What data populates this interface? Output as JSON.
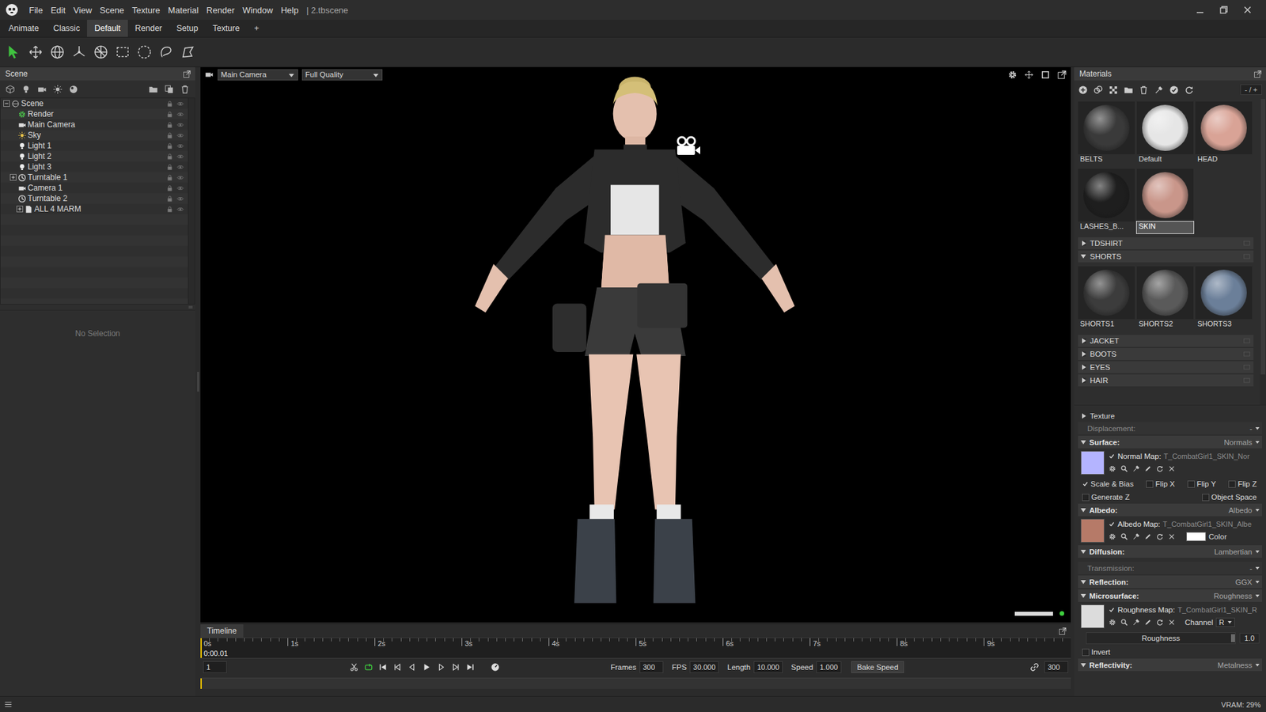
{
  "app": {
    "menu": [
      "File",
      "Edit",
      "View",
      "Scene",
      "Texture",
      "Material",
      "Render",
      "Window",
      "Help"
    ],
    "document": "| 2.tbscene"
  },
  "workspace_tabs": [
    {
      "label": "Animate",
      "selected": false
    },
    {
      "label": "Classic",
      "selected": false
    },
    {
      "label": "Default",
      "selected": true
    },
    {
      "label": "Render",
      "selected": false
    },
    {
      "label": "Setup",
      "selected": false
    },
    {
      "label": "Texture",
      "selected": false
    },
    {
      "label": "+",
      "selected": false
    }
  ],
  "scene": {
    "title": "Scene",
    "tree": [
      {
        "label": "Scene",
        "kind": "scene",
        "depth": 0,
        "expandable": true,
        "expanded": true
      },
      {
        "label": "Render",
        "kind": "render",
        "depth": 1,
        "expandable": false,
        "expanded": false
      },
      {
        "label": "Main Camera",
        "kind": "camera",
        "depth": 1,
        "expandable": false,
        "expanded": false
      },
      {
        "label": "Sky",
        "kind": "sky",
        "depth": 1,
        "expandable": false,
        "expanded": false
      },
      {
        "label": "Light 1",
        "kind": "light",
        "depth": 1,
        "expandable": false,
        "expanded": false
      },
      {
        "label": "Light 2",
        "kind": "light",
        "depth": 1,
        "expandable": false,
        "expanded": false
      },
      {
        "label": "Light 3",
        "kind": "light",
        "depth": 1,
        "expandable": false,
        "expanded": false
      },
      {
        "label": "Turntable 1",
        "kind": "turntable",
        "depth": 1,
        "expandable": true,
        "expanded": false
      },
      {
        "label": "Camera 1",
        "kind": "camera",
        "depth": 1,
        "expandable": false,
        "expanded": false
      },
      {
        "label": "Turntable 2",
        "kind": "turntable",
        "depth": 1,
        "expandable": false,
        "expanded": false
      },
      {
        "label": "ALL 4 MARM",
        "kind": "mesh",
        "depth": 2,
        "expandable": true,
        "expanded": false
      }
    ],
    "selection": "No Selection"
  },
  "viewport": {
    "camera": "Main Camera",
    "quality": "Full Quality"
  },
  "timeline": {
    "title": "Timeline",
    "ticks": [
      "0s",
      "1s",
      "2s",
      "3s",
      "4s",
      "5s",
      "6s",
      "7s",
      "8s",
      "9s"
    ],
    "time": "0:00.01",
    "playhead": 0.0,
    "frame": "1",
    "loop_on": true,
    "fields": [
      {
        "label": "Frames",
        "value": "300"
      },
      {
        "label": "FPS",
        "value": "30.000"
      },
      {
        "label": "Length",
        "value": "10.000"
      },
      {
        "label": "Speed",
        "value": "1.000"
      }
    ],
    "bake": "Bake Speed",
    "end_frame": "300"
  },
  "materials": {
    "title": "Materials",
    "zoom": "- / +",
    "loose": [
      {
        "label": "BELTS",
        "color": "#3a3a3a",
        "selected": false
      },
      {
        "label": "Default",
        "color": "#e6e6e6",
        "selected": false
      },
      {
        "label": "HEAD",
        "color": "#d9a396",
        "selected": false
      },
      {
        "label": "LASHES_B...",
        "color": "#1e1e1e",
        "selected": false
      },
      {
        "label": "SKIN",
        "color": "#c9968a",
        "selected": true
      }
    ],
    "groups": [
      {
        "label": "TDSHIRT",
        "expanded": false,
        "items": []
      },
      {
        "label": "SHORTS",
        "expanded": true,
        "items": [
          {
            "label": "SHORTS1",
            "color": "#3c3c3c",
            "selected": false
          },
          {
            "label": "SHORTS2",
            "color": "#5a5a5a",
            "selected": false
          },
          {
            "label": "SHORTS3",
            "color": "#6b7f99",
            "selected": false
          }
        ]
      },
      {
        "label": "JACKET",
        "expanded": false,
        "items": []
      },
      {
        "label": "BOOTS",
        "expanded": false,
        "items": []
      },
      {
        "label": "EYES",
        "expanded": false,
        "items": []
      },
      {
        "label": "HAIR",
        "expanded": false,
        "items": []
      }
    ]
  },
  "properties": [
    {
      "kind": "group",
      "label": "Texture",
      "expanded": false
    },
    {
      "kind": "section",
      "label": "Displacement:",
      "value": "-",
      "disabled": true
    },
    {
      "kind": "section",
      "label": "Surface:",
      "value": "Normals",
      "disabled": false,
      "expanded": true
    },
    {
      "kind": "map",
      "label": "Normal Map:",
      "file": "T_CombatGirl1_SKIN_Nor",
      "checked": true,
      "color": "#b4b4ff"
    },
    {
      "kind": "checks",
      "items": [
        {
          "label": "Scale & Bias",
          "checked": true
        },
        {
          "label": "Flip X",
          "checked": false
        },
        {
          "label": "Flip Y",
          "checked": false
        },
        {
          "label": "Flip Z",
          "checked": false
        }
      ]
    },
    {
      "kind": "checks",
      "items": [
        {
          "label": "Generate Z",
          "checked": false
        },
        {
          "label": "Object Space",
          "checked": false
        }
      ]
    },
    {
      "kind": "section",
      "label": "Albedo:",
      "value": "Albedo",
      "disabled": false,
      "expanded": true
    },
    {
      "kind": "map",
      "label": "Albedo Map:",
      "file": "T_CombatGirl1_SKIN_Albe",
      "checked": true,
      "color": "#b67a68",
      "extra": "Color",
      "extra_color": "#ffffff"
    },
    {
      "kind": "section",
      "label": "Diffusion:",
      "value": "Lambertian",
      "disabled": false,
      "expanded": true
    },
    {
      "kind": "section",
      "label": "Transmission:",
      "value": "-",
      "disabled": true
    },
    {
      "kind": "section",
      "label": "Reflection:",
      "value": "GGX",
      "disabled": false,
      "expanded": true
    },
    {
      "kind": "section",
      "label": "Microsurface:",
      "value": "Roughness",
      "disabled": false,
      "expanded": true
    },
    {
      "kind": "map",
      "label": "Roughness Map:",
      "file": "T_CombatGirl1_SKIN_R",
      "checked": true,
      "color": "#dcdcdc",
      "channel_label": "Channel",
      "channel": "R"
    },
    {
      "kind": "slider",
      "label": "Roughness",
      "value": "1.0",
      "level": 1.0
    },
    {
      "kind": "checks",
      "items": [
        {
          "label": "Invert",
          "checked": false
        }
      ]
    },
    {
      "kind": "section",
      "label": "Reflectivity:",
      "value": "Metalness",
      "disabled": false,
      "expanded": true
    }
  ],
  "status": {
    "vram": "VRAM: 29%"
  }
}
